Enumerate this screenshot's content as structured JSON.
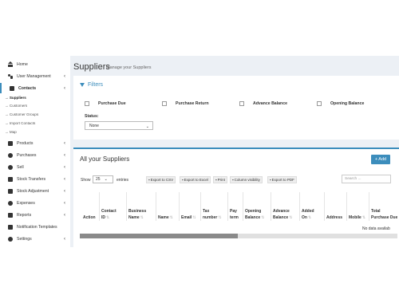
{
  "sidebar": {
    "items": [
      {
        "label": "Home",
        "icon": "home-icon",
        "chevron": ""
      },
      {
        "label": "User Management",
        "icon": "users-icon",
        "chevron": "‹"
      },
      {
        "label": "Contacts",
        "icon": "contacts-icon",
        "chevron": "‹"
      },
      {
        "label": "Products",
        "icon": "products-icon",
        "chevron": "‹"
      },
      {
        "label": "Purchases",
        "icon": "purchases-icon",
        "chevron": "‹"
      },
      {
        "label": "Sell",
        "icon": "sell-icon",
        "chevron": "‹"
      },
      {
        "label": "Stock Transfers",
        "icon": "truck-icon",
        "chevron": "‹"
      },
      {
        "label": "Stock Adjustment",
        "icon": "database-icon",
        "chevron": "‹"
      },
      {
        "label": "Expenses",
        "icon": "minus-circle-icon",
        "chevron": "‹"
      },
      {
        "label": "Reports",
        "icon": "chart-icon",
        "chevron": "‹"
      },
      {
        "label": "Notification Templates",
        "icon": "envelope-icon",
        "chevron": ""
      },
      {
        "label": "Settings",
        "icon": "gear-icon",
        "chevron": "‹"
      }
    ],
    "contacts_sub": [
      "→ Suppliers",
      "→ Customers",
      "→ Customer Groups",
      "→ Import Contacts",
      "→ Map"
    ]
  },
  "header": {
    "title": "Suppliers",
    "subtitle": "Manage your Suppliers"
  },
  "filters": {
    "title": "Filters",
    "checkboxes": [
      "Purchase Due",
      "Purchase Return",
      "Advance Balance",
      "Opening Balance"
    ],
    "status_label": "Status:",
    "status_value": "None"
  },
  "suppliers": {
    "title": "All your Suppliers",
    "add_label": "+ Add",
    "show_label": "Show",
    "show_value": "25",
    "entries_label": "entries",
    "export_buttons": [
      "Export to CSV",
      "Export to Excel",
      "Print",
      "Column visibility",
      "Export to PDF"
    ],
    "search_placeholder": "Search ...",
    "columns": [
      {
        "l1": "",
        "l2": "Action"
      },
      {
        "l1": "Contact",
        "l2": "ID"
      },
      {
        "l1": "Business",
        "l2": "Name"
      },
      {
        "l1": "",
        "l2": "Name"
      },
      {
        "l1": "",
        "l2": "Email"
      },
      {
        "l1": "Tax",
        "l2": "number"
      },
      {
        "l1": "Pay",
        "l2": "term"
      },
      {
        "l1": "Opening",
        "l2": "Balance"
      },
      {
        "l1": "Advance",
        "l2": "Balance"
      },
      {
        "l1": "Added",
        "l2": "On"
      },
      {
        "l1": "",
        "l2": "Address"
      },
      {
        "l1": "",
        "l2": "Mobile"
      },
      {
        "l1": "Total",
        "l2": "Purchase Due"
      }
    ],
    "no_data": "No data availab",
    "colors": {
      "accent": "#3c8dbc"
    }
  }
}
